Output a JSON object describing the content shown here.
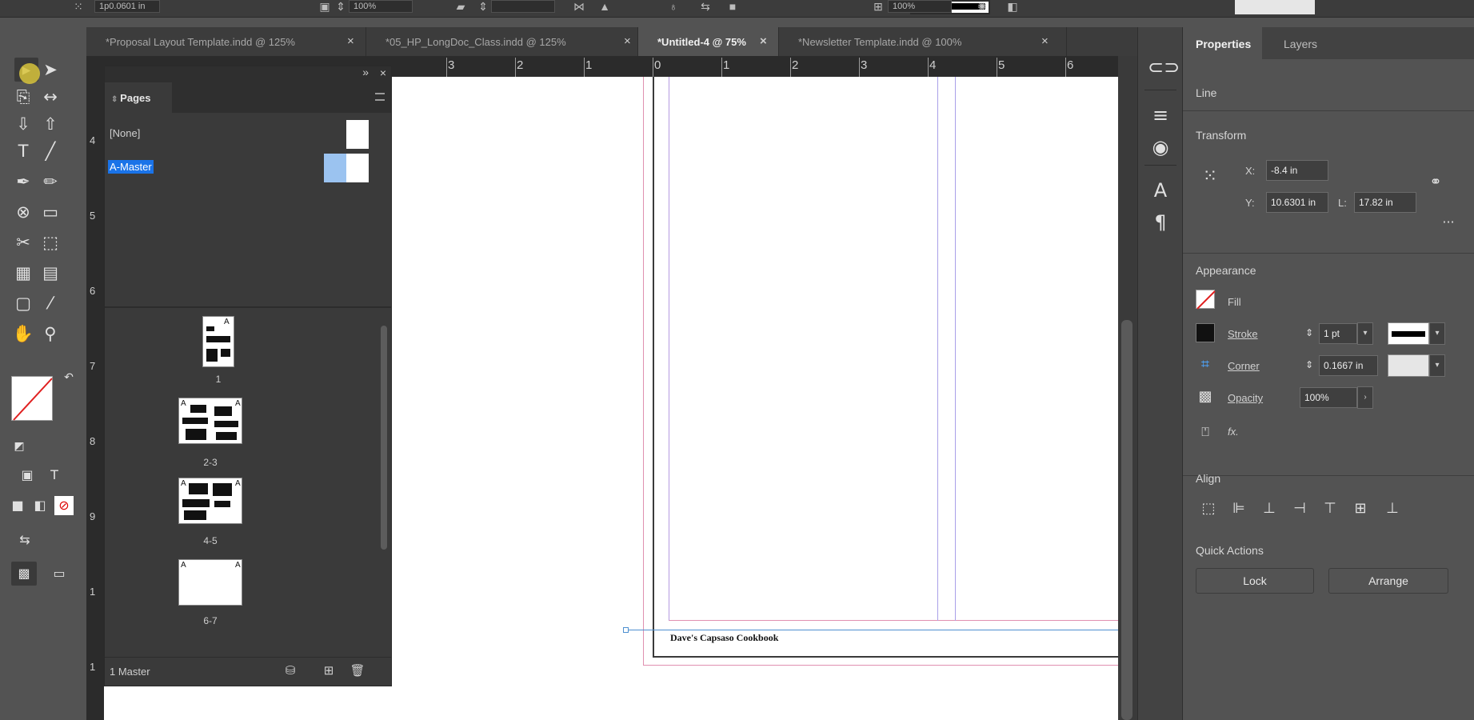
{
  "control_bar": {
    "field_1": "1p0.0601 in",
    "zoom_field": "100%",
    "zoom_field_2": "100%"
  },
  "doc_tabs": [
    {
      "label": "*Proposal Layout Template.indd @ 125%"
    },
    {
      "label": "*05_HP_LongDoc_Class.indd @ 125%"
    },
    {
      "label": "*Untitled-4 @ 75%"
    },
    {
      "label": "*Newsletter Template.indd @ 100%"
    }
  ],
  "tabs_overflow": "»",
  "ruler_top": [
    "3",
    "2",
    "1",
    "0",
    "1",
    "2",
    "3",
    "4",
    "5",
    "6"
  ],
  "ruler_left": [
    "4",
    "5",
    "6",
    "7",
    "8",
    "9",
    "1",
    "1"
  ],
  "pages_panel": {
    "title": "Pages",
    "masters": [
      {
        "label": "[None]"
      },
      {
        "label": "A-Master"
      }
    ],
    "spreads": [
      {
        "label": "1"
      },
      {
        "label": "2-3"
      },
      {
        "label": "4-5"
      },
      {
        "label": "6-7"
      }
    ],
    "master_letter": "A",
    "footer_text": "1 Master"
  },
  "document": {
    "footer_text": "Dave's Capsaso Cookbook"
  },
  "properties": {
    "tabs": [
      "Properties",
      "Layers"
    ],
    "object_type": "Line",
    "transform": {
      "title": "Transform",
      "x_label": "X:",
      "x_value": "-8.4 in",
      "y_label": "Y:",
      "y_value": "10.6301 in",
      "l_label": "L:",
      "l_value": "17.82 in"
    },
    "appearance": {
      "title": "Appearance",
      "fill_label": "Fill",
      "stroke_label": "Stroke",
      "stroke_value": "1 pt",
      "corner_label": "Corner",
      "corner_value": "0.1667 in",
      "opacity_label": "Opacity",
      "opacity_value": "100%",
      "fx_label": "fx."
    },
    "align": {
      "title": "Align"
    },
    "quick_actions": {
      "title": "Quick Actions",
      "lock": "Lock",
      "arrange": "Arrange"
    }
  }
}
